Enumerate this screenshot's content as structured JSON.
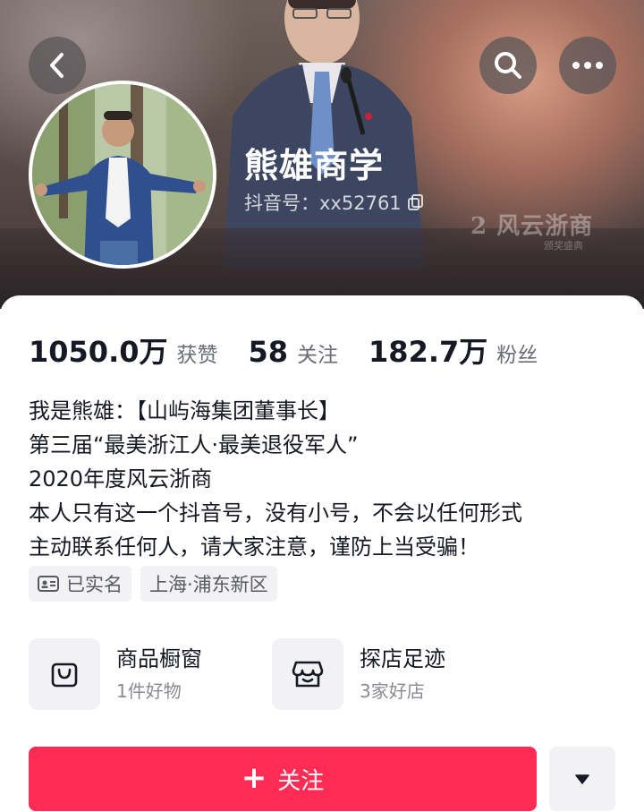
{
  "profile": {
    "nickname": "熊雄商学",
    "douyin_id": "抖音号：xx52761",
    "watermark": "2 风云浙商",
    "watermark_sub": "颁奖盛典"
  },
  "stats": [
    {
      "value": "1050.0万",
      "label": "获赞"
    },
    {
      "value": "58",
      "label": "关注"
    },
    {
      "value": "182.7万",
      "label": "粉丝"
    }
  ],
  "bio": [
    "我是熊雄：【山屿海集团董事长】",
    "第三届“最美浙江人·最美退役军人”",
    "2020年度风云浙商",
    "本人只有这一个抖音号，没有小号，不会以任何形式",
    "主动联系任何人，请大家注意，谨防上当受骗！"
  ],
  "tags": {
    "verified": "已实名",
    "location": "上海·浦东新区"
  },
  "services": [
    {
      "title": "商品橱窗",
      "subtitle": "1件好物"
    },
    {
      "title": "探店足迹",
      "subtitle": "3家好店"
    }
  ],
  "actions": {
    "follow_label": "关注",
    "follow_plus": "+"
  },
  "colors": {
    "accent": "#fe2c55",
    "text": "#161823",
    "muted": "#6b6d74",
    "chip_bg": "#f2f2f4"
  }
}
